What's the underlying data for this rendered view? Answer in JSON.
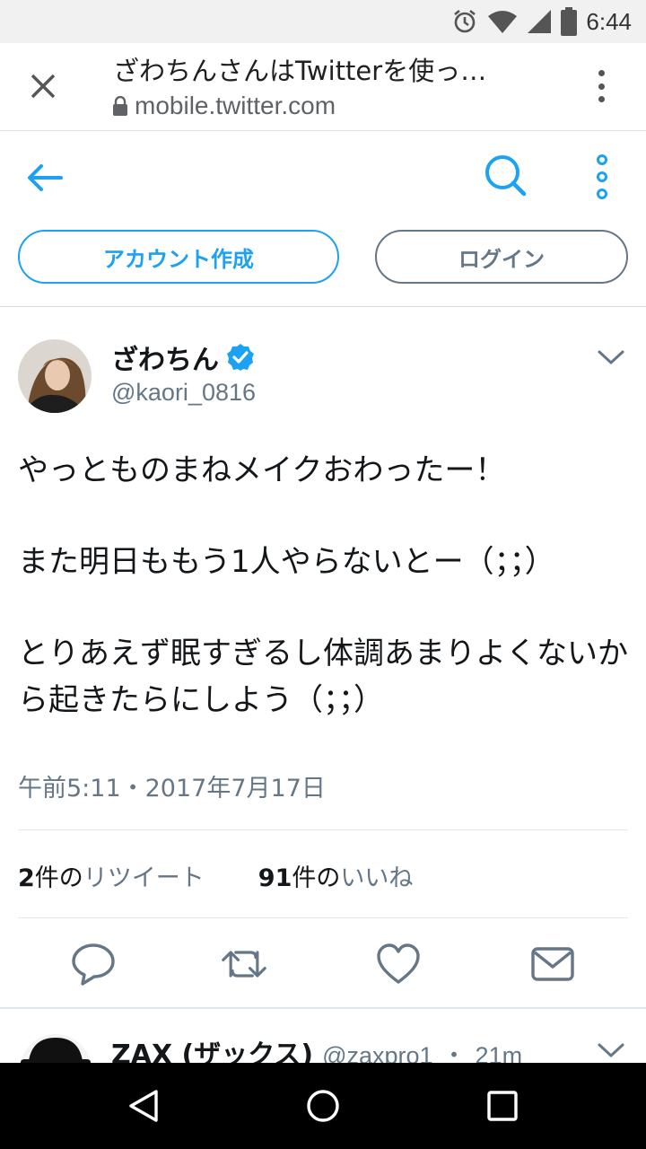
{
  "status_bar": {
    "time": "6:44",
    "icons": [
      "alarm-icon",
      "wifi-icon",
      "signal-icon",
      "battery-icon"
    ]
  },
  "browser": {
    "title": "ざわちんさんはTwitterを使っ…",
    "url": "mobile.twitter.com",
    "icons": [
      "close-icon",
      "lock-icon",
      "overflow-menu-icon"
    ]
  },
  "twitter_header": {
    "signup_label": "アカウント作成",
    "login_label": "ログイン",
    "accent_color": "#1da1f2",
    "icons": [
      "back-arrow-icon",
      "search-icon",
      "more-icon"
    ]
  },
  "tweet": {
    "display_name": "ざわちん",
    "verified": true,
    "handle": "@kaori_0816",
    "text_paragraphs": [
      "やっとものまねメイクおわったー！",
      "また明日ももう1人やらないとー（；；）",
      "とりあえず眠すぎるし体調あまりよくないから起きたらにしよう（；；）"
    ],
    "timestamp": "午前5:11・2017年7月17日",
    "retweets": {
      "count": "2",
      "unit": "件の",
      "label": "リツイート"
    },
    "likes": {
      "count": "91",
      "unit": "件の",
      "label": "いいね"
    },
    "actions": [
      "reply-icon",
      "retweet-icon",
      "like-icon",
      "message-icon"
    ]
  },
  "next_tweet": {
    "display_name": "ZAX (ザックス)",
    "handle": "@zaxpro1",
    "separator": "・",
    "time": "21m"
  },
  "nav_bar": {
    "icons": [
      "nav-back-icon",
      "nav-home-icon",
      "nav-recents-icon"
    ]
  }
}
